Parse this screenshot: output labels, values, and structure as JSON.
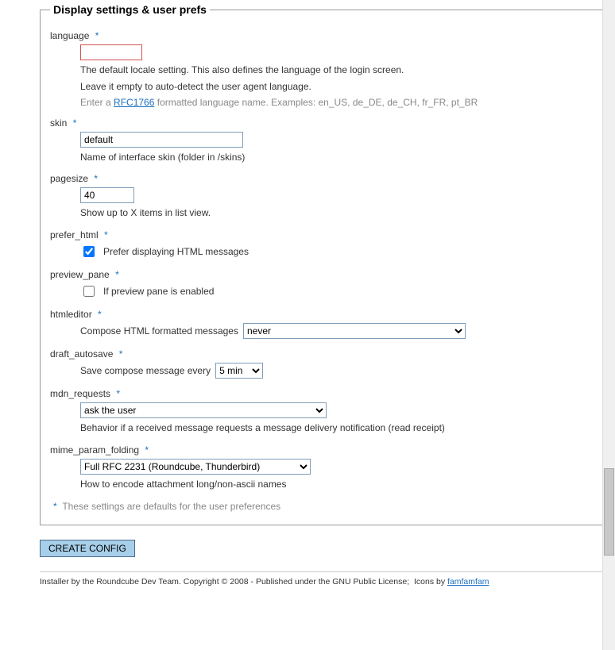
{
  "fieldset_title": "Display settings & user prefs",
  "language": {
    "label": "language",
    "value": "",
    "hint1": "The default locale setting. This also defines the language of the login screen.",
    "hint2": "Leave it empty to auto-detect the user agent language.",
    "hint3_pre": "Enter a ",
    "hint3_link": "RFC1766",
    "hint3_post": " formatted language name. Examples: en_US, de_DE, de_CH, fr_FR, pt_BR"
  },
  "skin": {
    "label": "skin",
    "value": "default",
    "hint": "Name of interface skin (folder in /skins)"
  },
  "pagesize": {
    "label": "pagesize",
    "value": "40",
    "hint": "Show up to X items in list view."
  },
  "prefer_html": {
    "label": "prefer_html",
    "text": "Prefer displaying HTML messages"
  },
  "preview_pane": {
    "label": "preview_pane",
    "text": "If preview pane is enabled"
  },
  "htmleditor": {
    "label": "htmleditor",
    "text": "Compose HTML formatted messages",
    "value": "never"
  },
  "draft_autosave": {
    "label": "draft_autosave",
    "text": "Save compose message every",
    "value": "5 min"
  },
  "mdn_requests": {
    "label": "mdn_requests",
    "value": "ask the user",
    "hint": "Behavior if a received message requests a message delivery notification (read receipt)"
  },
  "mime_param_folding": {
    "label": "mime_param_folding",
    "value": "Full RFC 2231 (Roundcube, Thunderbird)",
    "hint": "How to encode attachment long/non-ascii names"
  },
  "footnote": "These settings are defaults for the user preferences",
  "asterisk": "*",
  "button_label": "CREATE CONFIG",
  "copyright_pre": "Installer by the Roundcube Dev Team. Copyright © 2008 - Published under the GNU Public License;  Icons by ",
  "copyright_link": "famfamfam"
}
